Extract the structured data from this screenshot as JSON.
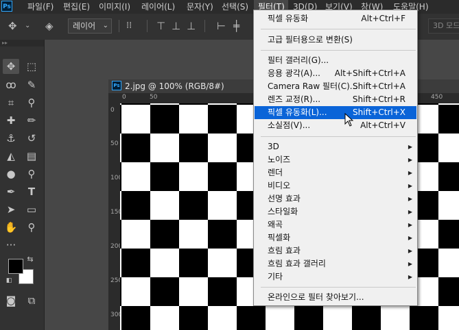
{
  "app": {
    "ps_logo_text": "Ps"
  },
  "menubar": {
    "items": [
      {
        "label": "파일(F)"
      },
      {
        "label": "편집(E)"
      },
      {
        "label": "이미지(I)"
      },
      {
        "label": "레이어(L)"
      },
      {
        "label": "문자(Y)"
      },
      {
        "label": "선택(S)"
      },
      {
        "label": "필터(T)"
      },
      {
        "label": "3D(D)"
      },
      {
        "label": "보기(V)"
      },
      {
        "label": "창(W)"
      },
      {
        "label": "도움말(H)"
      }
    ],
    "active_index": 6
  },
  "options_bar": {
    "layer_select_value": "레이어",
    "mode_3d_label": "3D 모드"
  },
  "toolbar": {
    "grip": "▸▸",
    "icons": [
      "move-icon",
      "marquee-icon",
      "lasso-icon",
      "quick-select-icon",
      "crop-icon",
      "eyedropper-icon",
      "healing-brush-icon",
      "brush-icon",
      "stamp-icon",
      "history-brush-icon",
      "eraser-icon",
      "gradient-icon",
      "blur-icon",
      "dodge-icon",
      "pen-icon",
      "type-icon",
      "path-select-icon",
      "rectangle-icon",
      "hand-icon",
      "zoom-icon",
      "more-tools-icon"
    ],
    "foreground_color": "#000000",
    "background_color": "#ffffff"
  },
  "document": {
    "tab_title": "2.jpg @ 100% (RGB/8#)",
    "ps_badge": "Ps",
    "ruler_top": [
      "0",
      "50",
      "450"
    ],
    "ruler_left": [
      "0",
      "50",
      "100",
      "150",
      "200",
      "250",
      "300"
    ]
  },
  "filter_menu": {
    "items": [
      {
        "label": "픽셀 유동화",
        "shortcut": "Alt+Ctrl+F"
      },
      {
        "label": "고급 필터용으로 변환(S)",
        "shortcut": ""
      },
      {
        "label": "필터 갤러리(G)...",
        "shortcut": ""
      },
      {
        "label": "응용 광각(A)...",
        "shortcut": "Alt+Shift+Ctrl+A"
      },
      {
        "label": "Camera Raw 필터(C)...",
        "shortcut": "Shift+Ctrl+A"
      },
      {
        "label": "렌즈 교정(R)...",
        "shortcut": "Shift+Ctrl+R"
      },
      {
        "label": "픽셀 유동화(L)...",
        "shortcut": "Shift+Ctrl+X",
        "highlighted": true
      },
      {
        "label": "소실점(V)...",
        "shortcut": "Alt+Ctrl+V"
      },
      {
        "label": "3D",
        "submenu": true
      },
      {
        "label": "노이즈",
        "submenu": true
      },
      {
        "label": "렌더",
        "submenu": true
      },
      {
        "label": "비디오",
        "submenu": true
      },
      {
        "label": "선명 효과",
        "submenu": true
      },
      {
        "label": "스타일화",
        "submenu": true
      },
      {
        "label": "왜곡",
        "submenu": true
      },
      {
        "label": "픽셀화",
        "submenu": true
      },
      {
        "label": "흐림 효과",
        "submenu": true
      },
      {
        "label": "흐림 효과 갤러리",
        "submenu": true
      },
      {
        "label": "기타",
        "submenu": true
      },
      {
        "label": "온라인으로 필터 찾아보기...",
        "shortcut": ""
      }
    ]
  },
  "colors": {
    "highlight": "#0a64d8",
    "menubar_bg": "#2b2b2b",
    "panel_bg": "#323232"
  }
}
